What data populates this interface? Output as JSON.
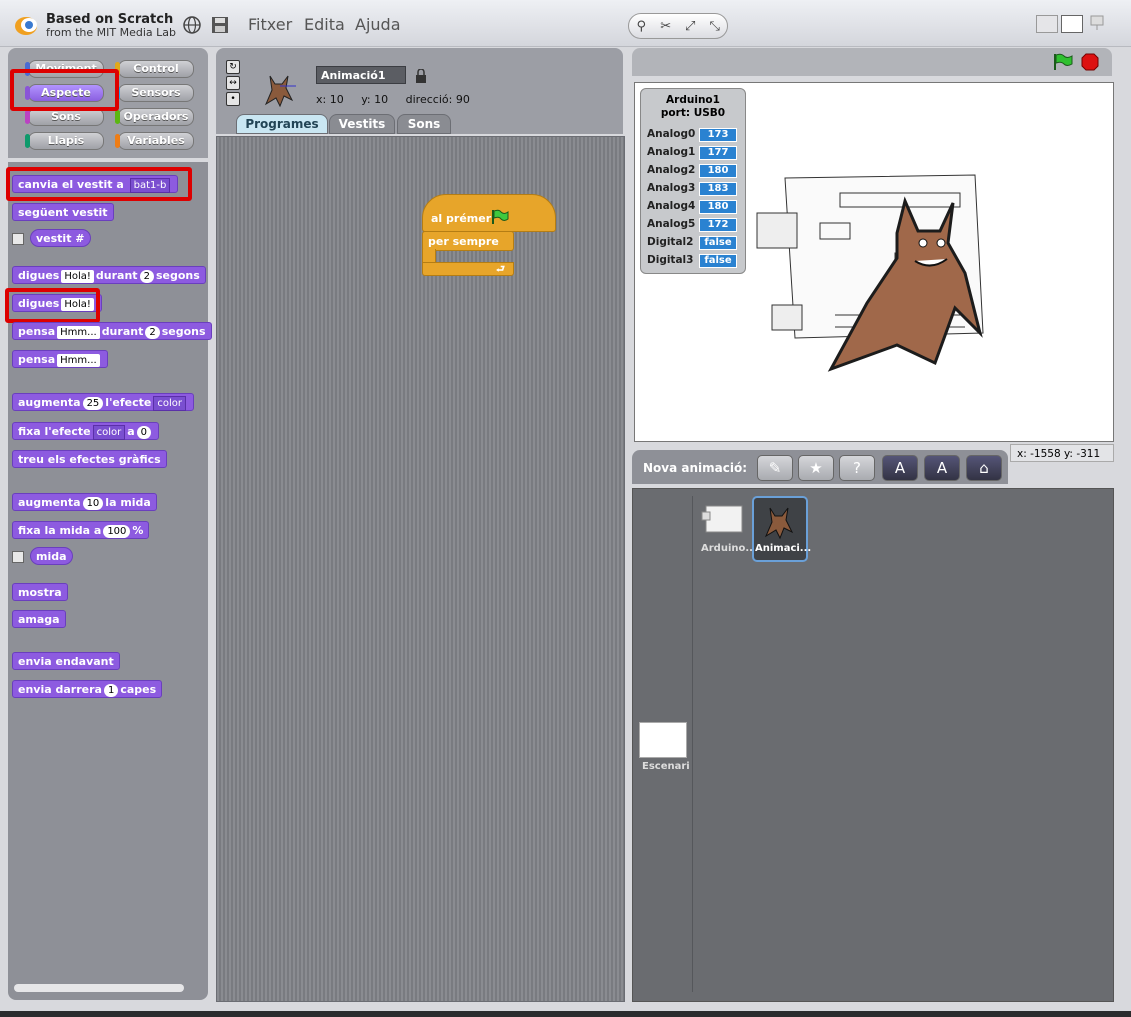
{
  "header": {
    "brand_title": "Based on Scratch",
    "brand_subtitle": "from the MIT Media Lab",
    "menu": [
      "Fitxer",
      "Edita",
      "Ajuda"
    ]
  },
  "palette": {
    "categories": [
      {
        "label": "Moviment",
        "color": "#4a6cd4"
      },
      {
        "label": "Control",
        "color": "#e1a91a"
      },
      {
        "label": "Aspecte",
        "color": "#8a55d7",
        "active": true
      },
      {
        "label": "Sensors",
        "color": "#2ca5e2"
      },
      {
        "label": "Sons",
        "color": "#bb42c3"
      },
      {
        "label": "Operadors",
        "color": "#5cb712"
      },
      {
        "label": "Llapis",
        "color": "#0e9a6c"
      },
      {
        "label": "Variables",
        "color": "#ee7d16"
      }
    ],
    "blocks": {
      "switch_costume": {
        "label": "canvia el vestit a",
        "value": "bat1-b"
      },
      "next_costume": "següent vestit",
      "costume_num": "vestit #",
      "say_for": {
        "label": "digues",
        "value": "Hola!",
        "mid": "durant",
        "num": "2",
        "unit": "segons"
      },
      "say": {
        "label": "digues",
        "value": "Hola!"
      },
      "think_for": {
        "label": "pensa",
        "value": "Hmm...",
        "mid": "durant",
        "num": "2",
        "unit": "segons"
      },
      "think": {
        "label": "pensa",
        "value": "Hmm..."
      },
      "change_effect": {
        "label": "augmenta",
        "num": "25",
        "mid": "l'efecte",
        "dd": "color"
      },
      "set_effect": {
        "label": "fixa l'efecte",
        "dd": "color",
        "mid": "a",
        "num": "0"
      },
      "clear_effects": "treu els efectes gràfics",
      "change_size": {
        "label": "augmenta",
        "num": "10",
        "end": "la mida"
      },
      "set_size": {
        "label": "fixa la mida a",
        "num": "100",
        "end": "%"
      },
      "size": "mida",
      "show": "mostra",
      "hide": "amaga",
      "front": "envia endavant",
      "back": {
        "label": "envia darrera",
        "num": "1",
        "end": "capes"
      }
    }
  },
  "sprite": {
    "name": "Animació1",
    "x_label": "x:",
    "x": "10",
    "y_label": "y:",
    "y": "10",
    "dir_label": "direcció:",
    "dir": "90"
  },
  "tabs": [
    "Programes",
    "Vestits",
    "Sons"
  ],
  "script": {
    "hat": "al prémer",
    "forever": "per sempre"
  },
  "watcher": {
    "title1": "Arduino1",
    "title2": "port: USB0",
    "rows": [
      {
        "name": "Analog0",
        "value": "173"
      },
      {
        "name": "Analog1",
        "value": "177"
      },
      {
        "name": "Analog2",
        "value": "180"
      },
      {
        "name": "Analog3",
        "value": "183"
      },
      {
        "name": "Analog4",
        "value": "180"
      },
      {
        "name": "Analog5",
        "value": "172"
      },
      {
        "name": "Digital2",
        "value": "false"
      },
      {
        "name": "Digital3",
        "value": "false"
      }
    ]
  },
  "coords": {
    "x_label": "x:",
    "x": "-1558",
    "y_label": "y:",
    "y": "-311"
  },
  "new_sprite_label": "Nova animació:",
  "corral": {
    "sprites": [
      "Arduino...",
      "Animaci..."
    ],
    "stage_label": "Escenari"
  }
}
